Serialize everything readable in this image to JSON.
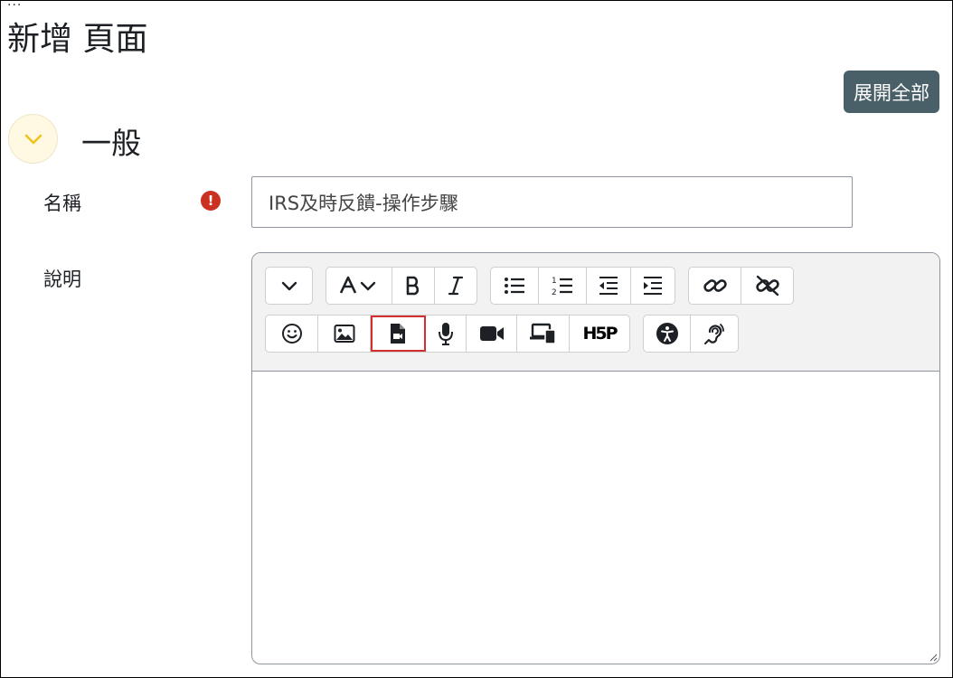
{
  "page": {
    "ellipsis": "...",
    "title": "新增 頁面",
    "expand_all_label": "展開全部"
  },
  "section": {
    "title": "一般"
  },
  "form": {
    "name_label": "名稱",
    "required_mark": "!",
    "name_value": "IRS及時反饋-操作步驟",
    "description_label": "說明"
  },
  "toolbar": {
    "row1": [
      {
        "name": "collapse-toolbar-button",
        "icon": "chevron-down-icon"
      },
      {
        "name": "paragraph-style-button",
        "icon": "font-style-icon"
      },
      {
        "name": "bold-button",
        "icon": "bold-icon"
      },
      {
        "name": "italic-button",
        "icon": "italic-icon"
      },
      {
        "name": "unordered-list-button",
        "icon": "bullet-list-icon"
      },
      {
        "name": "ordered-list-button",
        "icon": "numbered-list-icon"
      },
      {
        "name": "outdent-button",
        "icon": "outdent-icon"
      },
      {
        "name": "indent-button",
        "icon": "indent-icon"
      },
      {
        "name": "link-button",
        "icon": "link-icon"
      },
      {
        "name": "unlink-button",
        "icon": "unlink-icon"
      }
    ],
    "row2": [
      {
        "name": "emoji-button",
        "icon": "smiley-icon"
      },
      {
        "name": "image-button",
        "icon": "image-icon"
      },
      {
        "name": "media-button",
        "icon": "video-file-icon",
        "highlighted": true
      },
      {
        "name": "record-audio-button",
        "icon": "microphone-icon"
      },
      {
        "name": "record-video-button",
        "icon": "video-camera-icon"
      },
      {
        "name": "manage-files-button",
        "icon": "devices-icon"
      },
      {
        "name": "h5p-button",
        "icon": "h5p-icon",
        "text": "H5P"
      },
      {
        "name": "accessibility-checker-button",
        "icon": "accessibility-icon"
      },
      {
        "name": "screen-reader-helper-button",
        "icon": "hearing-icon"
      }
    ],
    "highlight_color": "#d32f2f"
  },
  "colors": {
    "expand_button_bg": "#4a6068",
    "required_icon": "#ca3120",
    "section_toggle_bg": "#fff8e2",
    "chevron": "#f0c419"
  }
}
